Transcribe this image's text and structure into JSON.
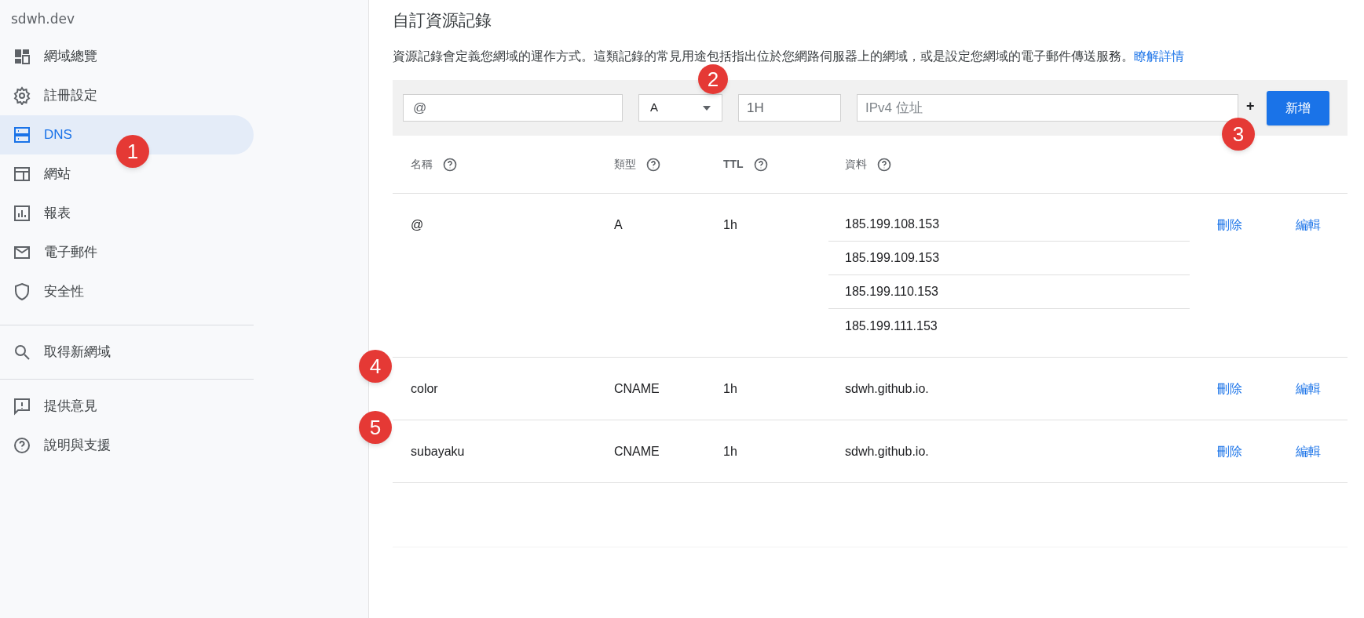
{
  "sidebar": {
    "domain": "sdwh.dev",
    "groups": [
      [
        {
          "kind": "dashboard",
          "label": "網域總覽",
          "selected": false
        },
        {
          "kind": "settings",
          "label": "註冊設定",
          "selected": false
        },
        {
          "kind": "dns",
          "label": "DNS",
          "selected": true
        },
        {
          "kind": "website",
          "label": "網站",
          "selected": false
        },
        {
          "kind": "report",
          "label": "報表",
          "selected": false
        },
        {
          "kind": "email",
          "label": "電子郵件",
          "selected": false
        },
        {
          "kind": "security",
          "label": "安全性",
          "selected": false
        }
      ],
      [
        {
          "kind": "search",
          "label": "取得新網域",
          "selected": false
        }
      ],
      [
        {
          "kind": "feedback",
          "label": "提供意見",
          "selected": false
        },
        {
          "kind": "help",
          "label": "說明與支援",
          "selected": false
        }
      ]
    ]
  },
  "main": {
    "title": "自訂資源記錄",
    "description": "資源記錄會定義您網域的運作方式。這類記錄的常見用途包括指出位於您網路伺服器上的網域，或是設定您網域的電子郵件傳送服務。",
    "learn_more": "瞭解詳情",
    "form": {
      "name": {
        "value": "@"
      },
      "type": {
        "value": "A"
      },
      "ttl": {
        "value": "1H"
      },
      "data": {
        "placeholder": "IPv4 位址"
      },
      "plus": "+",
      "submit": "新增"
    },
    "table": {
      "columns": [
        "名稱",
        "類型",
        "TTL",
        "資料"
      ],
      "rows": [
        {
          "name": "@",
          "type": "A",
          "ttl": "1h",
          "data": [
            "185.199.108.153",
            "185.199.109.153",
            "185.199.110.153",
            "185.199.111.153"
          ],
          "delete": "刪除",
          "edit": "編輯"
        },
        {
          "name": "color",
          "type": "CNAME",
          "ttl": "1h",
          "data": [
            "sdwh.github.io."
          ],
          "delete": "刪除",
          "edit": "編輯"
        },
        {
          "name": "subayaku",
          "type": "CNAME",
          "ttl": "1h",
          "data": [
            "sdwh.github.io."
          ],
          "delete": "刪除",
          "edit": "編輯"
        }
      ]
    }
  },
  "callouts": [
    "1",
    "2",
    "3",
    "4",
    "5"
  ]
}
